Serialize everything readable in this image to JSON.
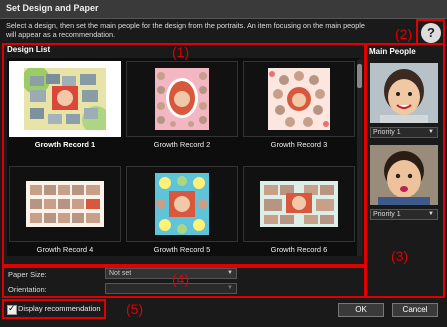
{
  "window": {
    "title": "Set Design and Paper"
  },
  "instructions": "Select a design, then set the main people for the design from the portraits. An item focusing on the main people will appear as a recommendation.",
  "help_icon": "question-mark-icon",
  "design_list": {
    "title": "Design List",
    "items": [
      {
        "label": "Growth Record 1",
        "selected": true
      },
      {
        "label": "Growth Record 2",
        "selected": false
      },
      {
        "label": "Growth Record 3",
        "selected": false
      },
      {
        "label": "Growth Record 4",
        "selected": false
      },
      {
        "label": "Growth Record 5",
        "selected": false
      },
      {
        "label": "Growth Record 6",
        "selected": false
      }
    ]
  },
  "main_people": {
    "title": "Main People",
    "people": [
      {
        "priority": "Priority 1"
      },
      {
        "priority": "Priority 1"
      }
    ]
  },
  "paper": {
    "paper_size_label": "Paper Size:",
    "paper_size_value": "Not set",
    "orientation_label": "Orientation:",
    "orientation_value": ""
  },
  "display_recommendation": {
    "label": "Display recommendation",
    "checked": true
  },
  "buttons": {
    "ok": "OK",
    "cancel": "Cancel"
  },
  "callouts": {
    "c1": "(1)",
    "c2": "(2)",
    "c3": "(3)",
    "c4": "(4)",
    "c5": "(5)"
  },
  "colors": {
    "callout_red": "#e00000",
    "background": "#1a1a1a"
  }
}
